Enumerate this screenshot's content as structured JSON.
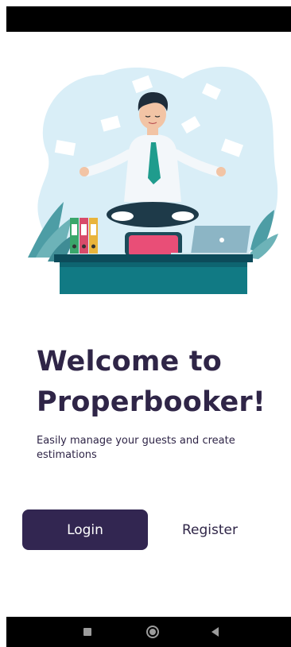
{
  "welcome": {
    "title_line1": "Welcome to",
    "title_line2": "Properbooker!",
    "subtitle": "Easily manage your guests and create estimations"
  },
  "actions": {
    "login_label": "Login",
    "register_label": "Register"
  },
  "illustration": {
    "description_icon": "meditating-person-illustration"
  },
  "system_nav": {
    "recent_icon": "square-recent-apps-icon",
    "home_icon": "circle-home-icon",
    "back_icon": "triangle-back-icon"
  },
  "colors": {
    "primary": "#322651",
    "text": "#2f2547",
    "blob": "#d9eef7",
    "desk": "#117a84"
  }
}
